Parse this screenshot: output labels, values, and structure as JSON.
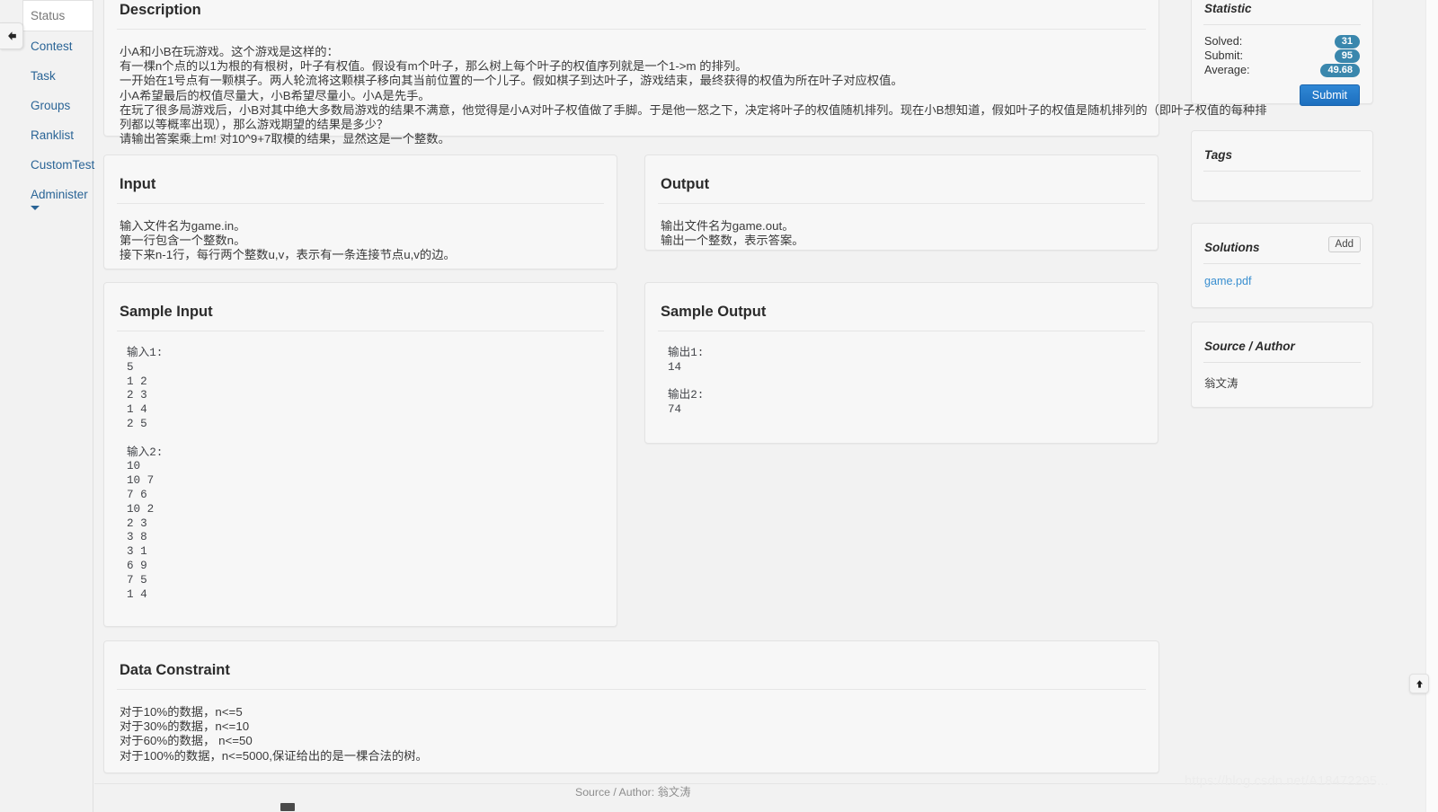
{
  "sidebar": {
    "items": [
      {
        "label": "Status",
        "active": true
      },
      {
        "label": "Contest",
        "active": false
      },
      {
        "label": "Task",
        "active": false
      },
      {
        "label": "Groups",
        "active": false
      },
      {
        "label": "Ranklist",
        "active": false
      },
      {
        "label": "CustomTest",
        "active": false
      },
      {
        "label": "Administer",
        "active": false
      }
    ]
  },
  "description": {
    "title": "Description",
    "lines": [
      "小A和小B在玩游戏。这个游戏是这样的：",
      "有一棵n个点的以1为根的有根树，叶子有权值。假设有m个叶子，那么树上每个叶子的权值序列就是一个1->m 的排列。",
      "一开始在1号点有一颗棋子。两人轮流将这颗棋子移向其当前位置的一个儿子。假如棋子到达叶子，游戏结束，最终获得的权值为所在叶子对应权值。",
      "小A希望最后的权值尽量大，小B希望尽量小。小A是先手。",
      "在玩了很多局游戏后，小B对其中绝大多数局游戏的结果不满意，他觉得是小A对叶子权值做了手脚。于是他一怒之下，决定将叶子的权值随机排列。现在小B想知道，假如叶子的权值是随机排列的（即叶子权值的每种排",
      "列都以等概率出现），那么游戏期望的结果是多少？",
      "请输出答案乘上m! 对10^9+7取模的结果，显然这是一个整数。"
    ]
  },
  "input": {
    "title": "Input",
    "lines": [
      "输入文件名为game.in。",
      "第一行包含一个整数n。",
      "接下来n-1行，每行两个整数u,v，表示有一条连接节点u,v的边。"
    ]
  },
  "output": {
    "title": "Output",
    "lines": [
      "输出文件名为game.out。",
      "输出一个整数，表示答案。"
    ]
  },
  "sample_input": {
    "title": "Sample Input",
    "text": "输入1:\n5\n1 2\n2 3\n1 4\n2 5\n\n输入2:\n10\n10 7\n7 6\n10 2\n2 3\n3 8\n3 1\n6 9\n7 5\n1 4"
  },
  "sample_output": {
    "title": "Sample Output",
    "text": "输出1:\n14\n\n输出2:\n74"
  },
  "data_constraint": {
    "title": "Data Constraint",
    "lines": [
      "对于10%的数据，n<=5",
      "对于30%的数据，n<=10",
      "对于60%的数据， n<=50",
      "对于100%的数据，n<=5000,保证给出的是一棵合法的树。"
    ]
  },
  "statistic": {
    "title": "Statistic",
    "rows": [
      {
        "label": "Solved:",
        "value": "31"
      },
      {
        "label": "Submit:",
        "value": "95"
      },
      {
        "label": "Average:",
        "value": "49.68"
      }
    ],
    "submit_label": "Submit",
    "badge_color": "#3a87ad",
    "submit_color": "#1d6fbf"
  },
  "tags": {
    "title": "Tags",
    "items": []
  },
  "solutions": {
    "title": "Solutions",
    "add_label": "Add",
    "files": [
      "game.pdf"
    ]
  },
  "source_author": {
    "title": "Source / Author",
    "value": "翁文涛"
  },
  "footer": {
    "text": "Source / Author: 翁文涛"
  },
  "watermark": {
    "text": "https://blog.csdn.net/A18472295..."
  },
  "icons": {
    "collapse": "arrow-left-icon",
    "back_to_top": "arrow-up-icon",
    "administer_caret": "caret-down-icon"
  }
}
